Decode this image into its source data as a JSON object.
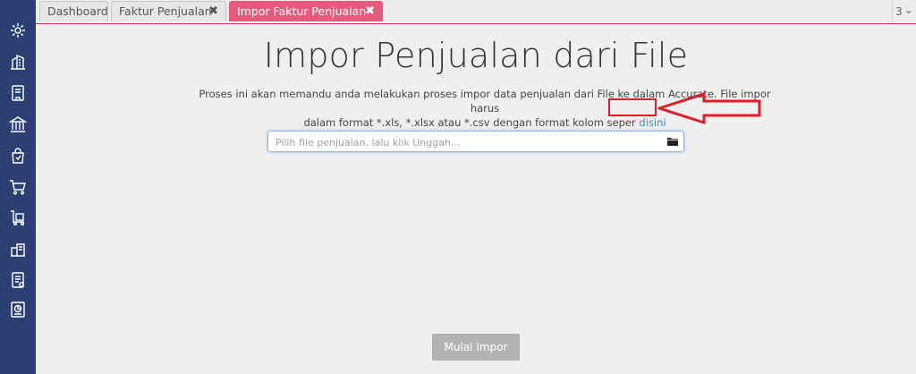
{
  "tabs": [
    {
      "label": "Dashboard",
      "closable": false,
      "active": false
    },
    {
      "label": "Faktur Penjualan",
      "closable": true,
      "active": false
    },
    {
      "label": "Impor Faktur Penjualan",
      "closable": true,
      "active": true
    }
  ],
  "tab_close_glyph": "✖",
  "tab_count": "3",
  "tab_count_chevron": "⌄",
  "sidebar": {
    "icons": [
      "gear-icon",
      "building-icon",
      "book-icon",
      "bank-icon",
      "sales-bag-icon",
      "cart-icon",
      "delivery-icon",
      "inventory-icon",
      "tax-document-icon",
      "report-icon"
    ]
  },
  "main": {
    "title": "Impor Penjualan dari File",
    "description_line1": "Proses ini akan memandu anda melakukan proses impor data penjualan dari File ke dalam Accurate. File impor harus",
    "description_line2": "dalam format *.xls, *.xlsx atau *.csv dengan format kolom seper",
    "description_link": "disini",
    "file_input_placeholder": "Pilih file penjualan, lalu klik Unggah...",
    "file_input_value": "",
    "submit_label": "Mulai Impor"
  },
  "colors": {
    "sidebar": "#2b3f73",
    "active_tab": "#e85a7c",
    "annotation": "#d8222a",
    "link": "#2d8fc2",
    "button_disabled": "#b3b3b3"
  }
}
